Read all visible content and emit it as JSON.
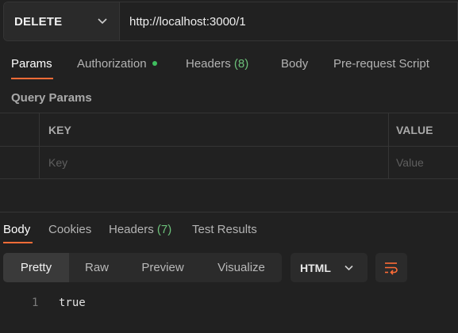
{
  "request": {
    "method": "DELETE",
    "url": "http://localhost:3000/1"
  },
  "request_tabs": [
    {
      "label": "Params",
      "active": true
    },
    {
      "label": "Authorization",
      "status_dot": "green"
    },
    {
      "label": "Headers",
      "count": "(8)"
    },
    {
      "label": "Body"
    },
    {
      "label": "Pre-request Script"
    }
  ],
  "query_params": {
    "title": "Query Params",
    "columns": [
      "KEY",
      "VALUE"
    ],
    "placeholders": [
      "Key",
      "Value"
    ]
  },
  "response_tabs": [
    {
      "label": "Body",
      "active": true
    },
    {
      "label": "Cookies"
    },
    {
      "label": "Headers",
      "count": "(7)"
    },
    {
      "label": "Test Results"
    }
  ],
  "view_modes": [
    "Pretty",
    "Raw",
    "Preview",
    "Visualize"
  ],
  "active_view_mode": "Pretty",
  "format": "HTML",
  "response_body": [
    {
      "line": "1",
      "text": "true"
    }
  ],
  "colors": {
    "accent": "#ff6c37",
    "status_green": "#3fbf5f",
    "count_green": "#6cc07a",
    "background": "#212121"
  },
  "icons": {
    "method_dropdown": "chevron-down-icon",
    "format_dropdown": "chevron-down-icon",
    "wrap": "wrap-lines-icon"
  }
}
